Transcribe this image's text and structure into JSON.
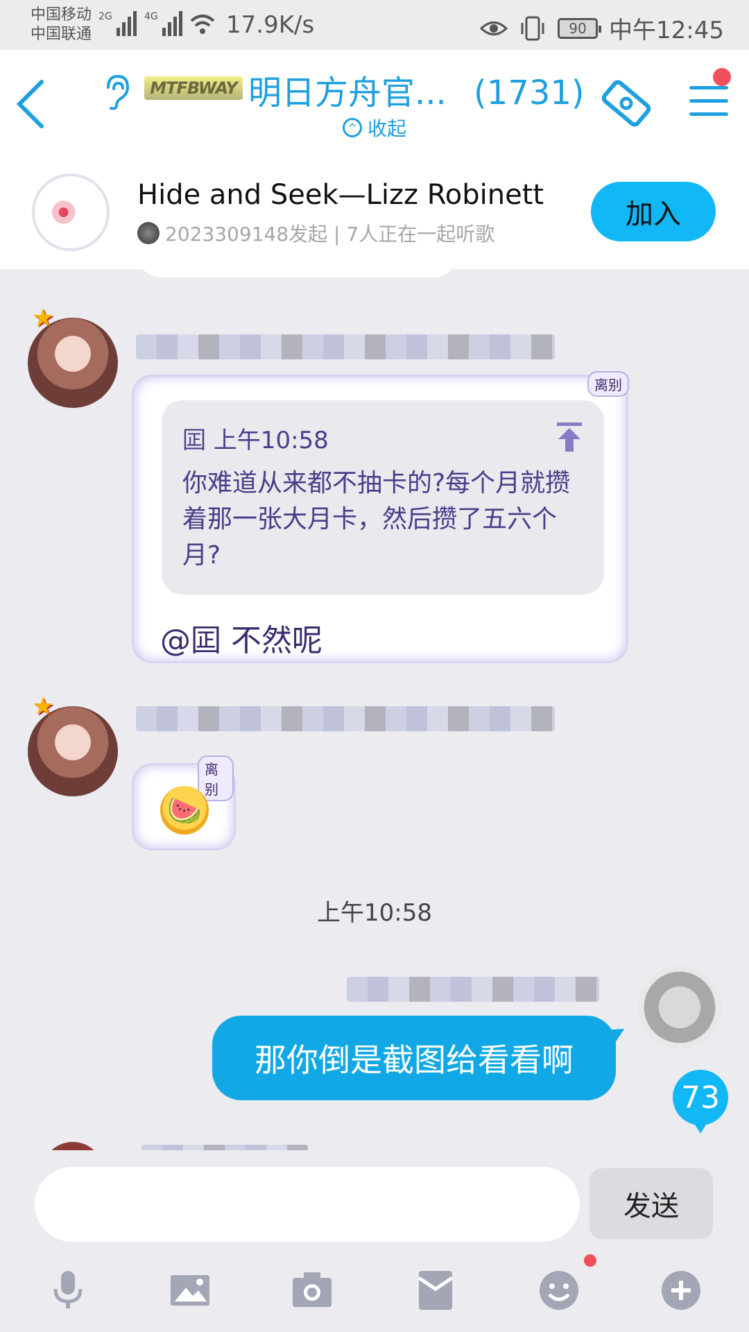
{
  "status_bar": {
    "carrier_1": "中国移动",
    "carrier_2": "中国联通",
    "net_2g": "2G",
    "net_4g": "4G",
    "speed": "17.9K/s",
    "battery": "90",
    "time": "中午12:45"
  },
  "header": {
    "badge": "MTFBWAY",
    "title": "明日方舟官...",
    "member_count": "(1731)",
    "collapse_label": "收起",
    "accent_color": "#1ea0e0"
  },
  "music": {
    "song_title": "Hide and Seek—Lizz Robinett",
    "subtitle": "2023309148发起 | 7人正在一起听歌",
    "join_label": "加入"
  },
  "messages": {
    "msg1": {
      "tag": "离别",
      "quote_header": "囸 上午10:58",
      "quote_text": "你难道从来都不抽卡的?每个月就攒着那一张大月卡，然后攒了五六个月?",
      "reply_text": "@囸 不然呢"
    },
    "msg2": {
      "tag": "离别"
    },
    "timestamp": "上午10:58",
    "msg3": {
      "text": "那你倒是截图给看看啊"
    },
    "unread_count": "73"
  },
  "input": {
    "placeholder": "",
    "send_label": "发送"
  },
  "toolbar": {
    "icons": [
      "microphone-icon",
      "image-icon",
      "camera-icon",
      "red-packet-icon",
      "emoji-icon",
      "plus-icon"
    ]
  }
}
